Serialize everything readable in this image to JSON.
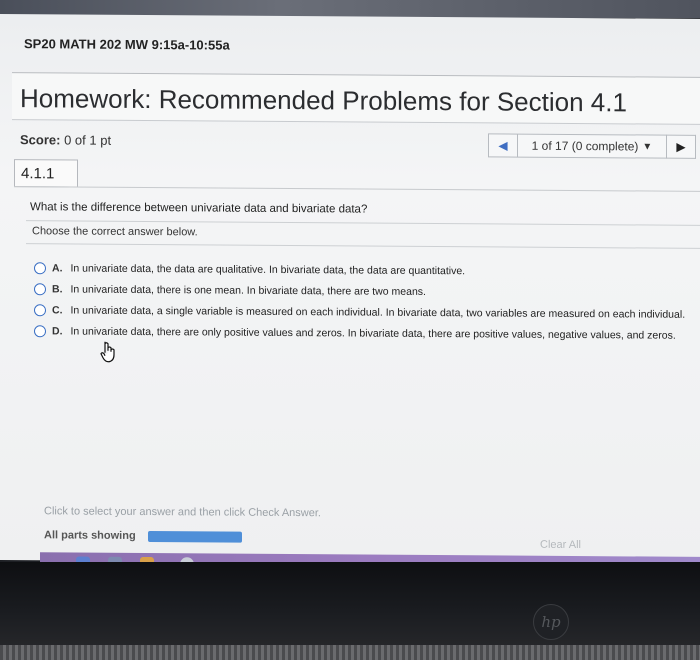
{
  "course": {
    "title": "SP20 MATH 202 MW 9:15a-10:55a"
  },
  "homework": {
    "title": "Homework: Recommended Problems for Section 4.1"
  },
  "score": {
    "label": "Score:",
    "value": "0 of 1 pt"
  },
  "nav": {
    "prev_icon": "◀",
    "position": "1 of 17 (0 complete)",
    "dropdown_icon": "▼",
    "next_icon": "▶"
  },
  "section": {
    "number": "4.1.1"
  },
  "question": {
    "text": "What is the difference between univariate data and bivariate data?",
    "instruction": "Choose the correct answer below."
  },
  "options": [
    {
      "letter": "A.",
      "text": "In univariate data, the data are qualitative. In bivariate data, the data are quantitative."
    },
    {
      "letter": "B.",
      "text": "In univariate data, there is one mean. In bivariate data, there are two means."
    },
    {
      "letter": "C.",
      "text": "In univariate data, a single variable is measured on each individual. In bivariate data, two variables are measured on each individual."
    },
    {
      "letter": "D.",
      "text": "In univariate data, there are only positive values and zeros. In bivariate data, there are positive values, negative values, and zeros."
    }
  ],
  "footer": {
    "hint": "Click to select your answer and then click Check Answer.",
    "parts": "All parts showing",
    "clear_all": "Clear All"
  },
  "bezel": {
    "logo": "hp"
  },
  "colors": {
    "accent": "#3a6fc4",
    "progress": "#4f8fd8",
    "taskbar": "#9c7cc0"
  }
}
